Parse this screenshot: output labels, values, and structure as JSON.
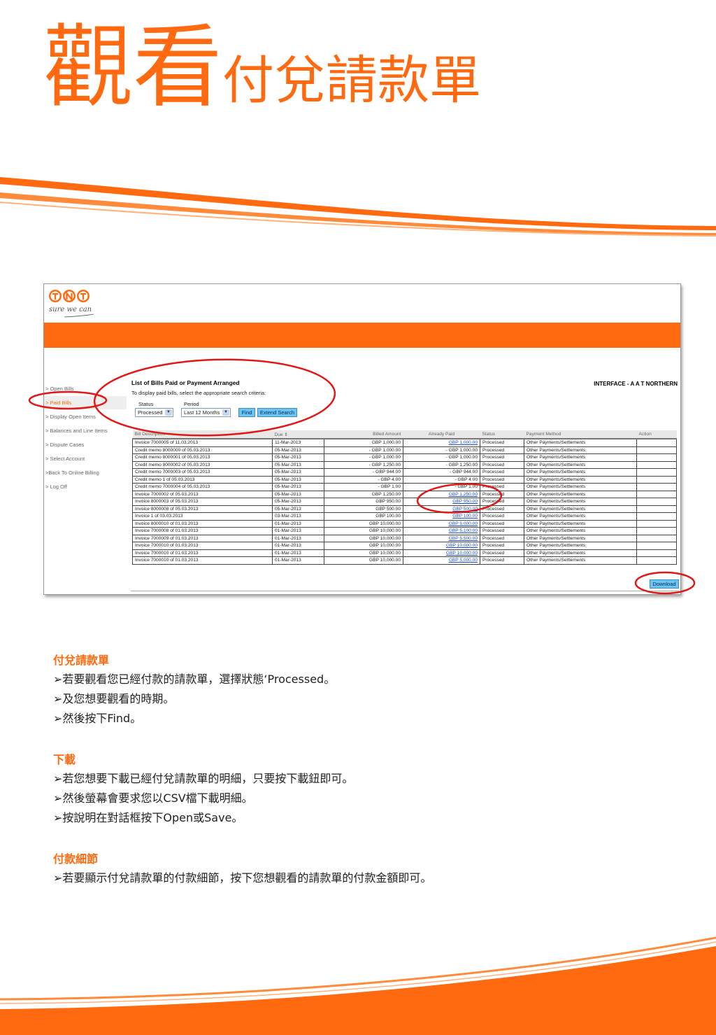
{
  "title": {
    "big": "觀看",
    "small": "付兌請款單"
  },
  "screenshot": {
    "logo_tagline": "sure we can",
    "sidebar": [
      "> Open Bills",
      "> Paid Bills",
      "> Display Open Items",
      "> Balances and Line Items",
      "> Dispute Cases",
      "> Select Account",
      ">Back To Online Billing",
      "> Log Off"
    ],
    "main_title": "List of Bills Paid or Payment Arranged",
    "main_subtitle": "To display paid bills, select the appropriate search criteria:",
    "interface_label": "INTERFACE - A A T NORTHERN",
    "status_label": "Status",
    "status_value": "Processed",
    "period_label": "Period",
    "period_value": "Last 12 Months",
    "find_button": "Find",
    "extend_search_button": "Extend Search",
    "download_button": "Download",
    "table": {
      "headers": [
        "Bill Description",
        "Due ⇕",
        "Billed Amount",
        "Already Paid",
        "Status",
        "Payment Method",
        "Action"
      ],
      "rows": [
        [
          "Invoice 7000005 of 11.03.2013",
          "11-Mar-2013",
          "GBP 1,000.00",
          "GBP 1,000.00",
          "Processed",
          "Other Payments/Settlements",
          ""
        ],
        [
          "Credit memo 8000000 of 05.03.2013",
          "05-Mar-2013",
          "- GBP 1,000.00",
          "- GBP 1,000.00",
          "Processed",
          "Other Payments/Settlements",
          ""
        ],
        [
          "Credit memo 8000001 of 05.03.2013",
          "05-Mar-2013",
          "- GBP 1,000.00",
          "- GBP 1,000.00",
          "Processed",
          "Other Payments/Settlements",
          ""
        ],
        [
          "Credit memo 8000002 of 05.03.2013",
          "05-Mar-2013",
          "- GBP 1,250.00",
          "- GBP 1,250.00",
          "Processed",
          "Other Payments/Settlements",
          ""
        ],
        [
          "Credit memo 7000003 of 05.03.2013",
          "05-Mar-2013",
          "- GBP 944.00",
          "- GBP 944.00",
          "Processed",
          "Other Payments/Settlements",
          ""
        ],
        [
          "Credit memo 1 of 05.03.2013",
          "05-Mar-2013",
          "- GBP 4.00",
          "- GBP 4.00",
          "Processed",
          "Other Payments/Settlements",
          ""
        ],
        [
          "Credit memo 7000004 of 05.03.2013",
          "05-Mar-2013",
          "- GBP 1.00",
          "- GBP 1.00",
          "Processed",
          "Other Payments/Settlements",
          ""
        ],
        [
          "Invoice 7000002 of 05.03.2013",
          "05-Mar-2013",
          "GBP 1,250.00",
          "GBP 1,250.00",
          "Processed",
          "Other Payments/Settlements",
          ""
        ],
        [
          "Invoice 8000003 of 05.03.2013",
          "05-Mar-2013",
          "GBP 950.00",
          "GBP 950.00",
          "Processed",
          "Other Payments/Settlements",
          ""
        ],
        [
          "Invoice 8000008 of 05.03.2013",
          "05-Mar-2013",
          "GBP 500.00",
          "GBP 500.00",
          "Processed",
          "Other Payments/Settlements",
          ""
        ],
        [
          "Invoice 1 of 03.03.2013",
          "03-Mar-2013",
          "GBP 100.00",
          "GBP 100.00",
          "Processed",
          "Other Payments/Settlements",
          ""
        ],
        [
          "Invoice 8000010 of 01.03.2013",
          "01-Mar-2013",
          "GBP 10,000.00",
          "GBP 5,000.00",
          "Processed",
          "Other Payments/Settlements",
          ""
        ],
        [
          "Invoice 7000008 of 01.03.2013",
          "01-Mar-2013",
          "GBP 10,000.00",
          "GBP 5,100.00",
          "Processed",
          "Other Payments/Settlements",
          ""
        ],
        [
          "Invoice 7000009 of 01.03.2013",
          "01-Mar-2013",
          "GBP 10,000.00",
          "GBP 5,500.00",
          "Processed",
          "Other Payments/Settlements",
          ""
        ],
        [
          "Invoice 7000010 of 01.03.2013",
          "01-Mar-2013",
          "GBP 10,000.00",
          "GBP 10,000.00",
          "Processed",
          "Other Payments/Settlements",
          ""
        ],
        [
          "Invoice 7000010 of 01.03.2013",
          "01-Mar-2013",
          "GBP 10,000.00",
          "GBP 10,000.00",
          "Processed",
          "Other Payments/Settlements",
          ""
        ],
        [
          "Invoice 7000010 of 01.03.2013",
          "01-Mar-2013",
          "GBP 10,000.00",
          "GBP 5,000.00",
          "Processed",
          "Other Payments/Settlements",
          ""
        ]
      ]
    }
  },
  "sections": [
    {
      "heading": "付兌請款單",
      "lines": [
        "➢若要觀看您已經付款的請款單，選擇狀態‘Processed。",
        "➢及您想要觀看的時期。",
        "➢然後按下Find。"
      ]
    },
    {
      "heading": "下載",
      "lines": [
        "➢若您想要下載已經付兌請款單的明細，只要按下載鈕即可。",
        "➢然後螢幕會要求您以CSV檔下載明細。",
        "➢按說明在對話框按下Open或Save。"
      ]
    },
    {
      "heading": "付款細節",
      "lines": [
        "➢若要顯示付兌請款單的付款細節，按下您想觀看的請款單的付款金額即可。"
      ]
    }
  ],
  "colors": {
    "accent": "#ff6a10",
    "annotation": "#e01818",
    "link": "#1a4fd1"
  }
}
